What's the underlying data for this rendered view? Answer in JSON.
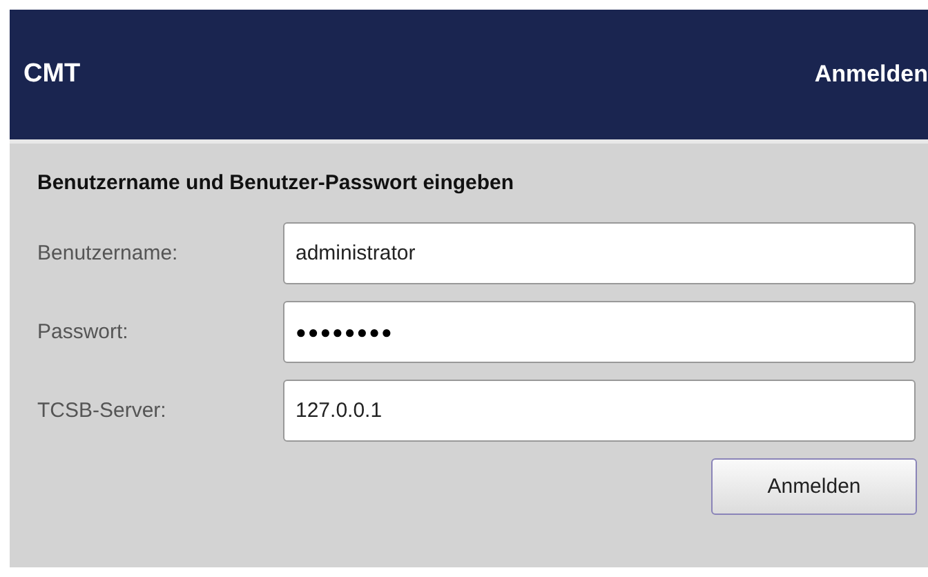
{
  "header": {
    "title": "CMT",
    "link": "Anmelden"
  },
  "form": {
    "heading": "Benutzername und Benutzer-Passwort eingeben",
    "fields": [
      {
        "label": "Benutzername:",
        "value": "administrator"
      },
      {
        "label": "Passwort:",
        "value": "●●●●●●●●"
      },
      {
        "label": "TCSB-Server:",
        "value": "127.0.0.1"
      }
    ],
    "submit": "Anmelden"
  }
}
